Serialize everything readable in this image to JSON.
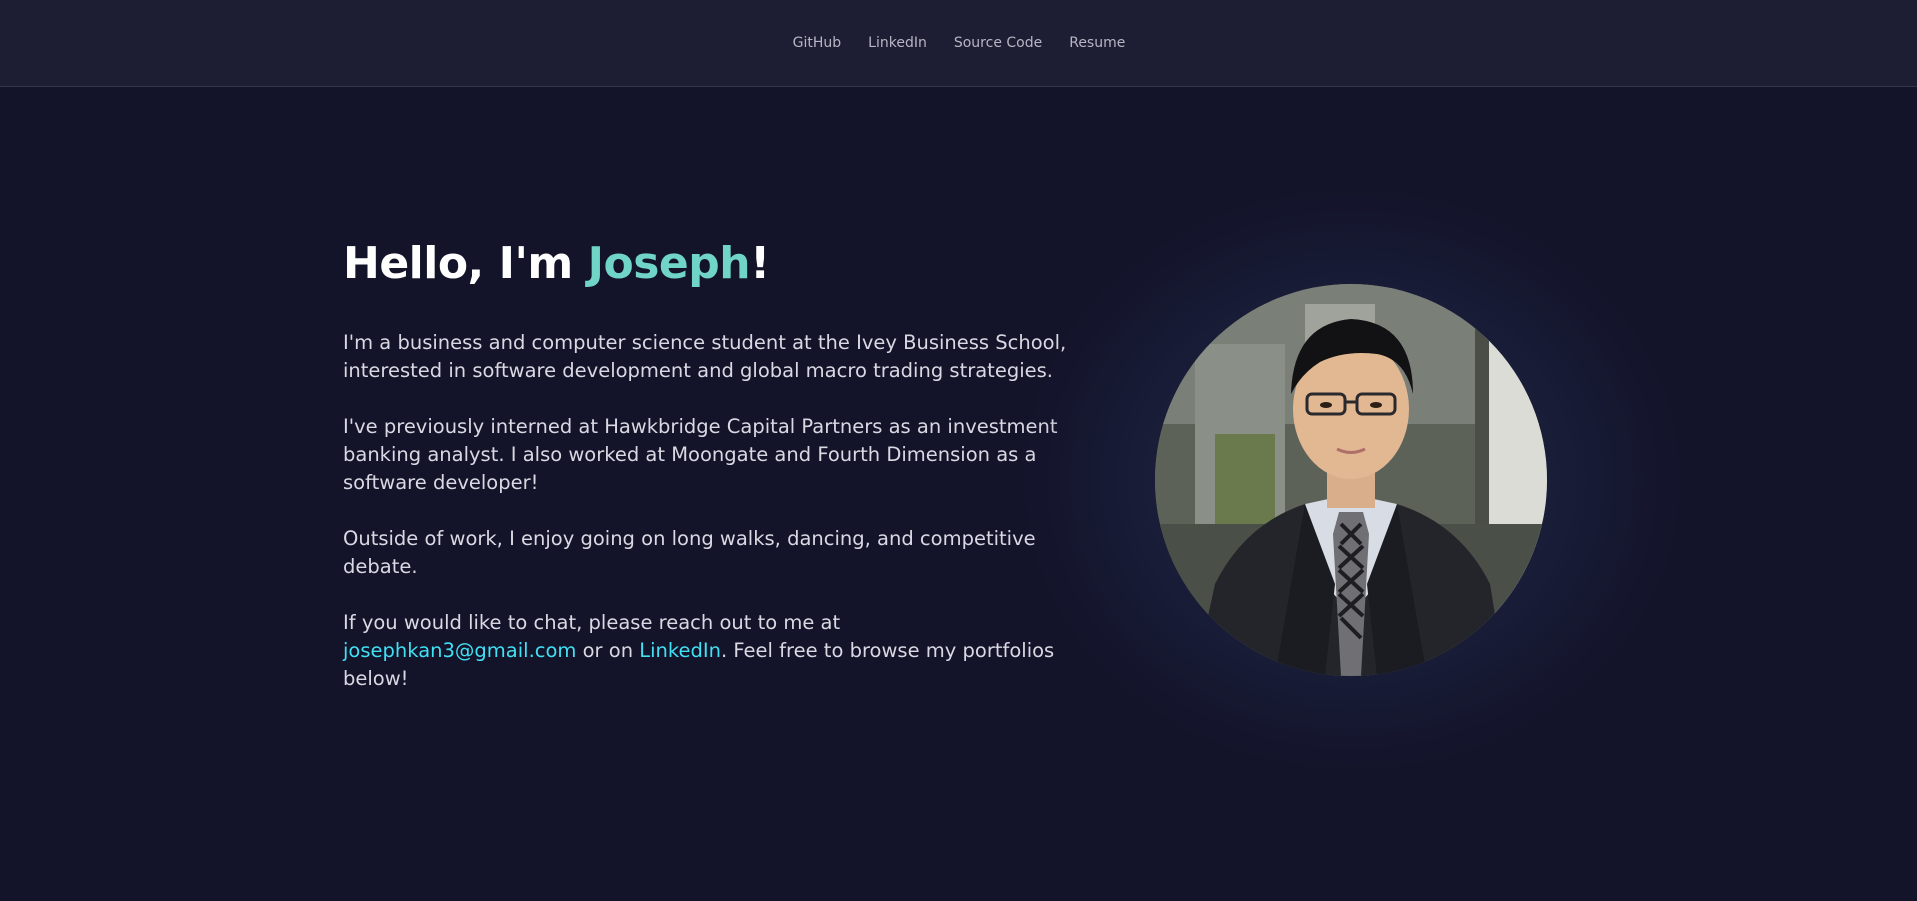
{
  "nav": {
    "items": [
      {
        "label": "GitHub"
      },
      {
        "label": "LinkedIn"
      },
      {
        "label": "Source Code"
      },
      {
        "label": "Resume"
      }
    ]
  },
  "hero": {
    "title_prefix": "Hello, I'm ",
    "title_name": "Joseph",
    "title_suffix": "!",
    "paragraph1": "I'm a business and computer science student at the Ivey Business School, interested in software development and global macro trading strategies.",
    "paragraph2": "I've previously interned at Hawkbridge Capital Partners as an investment banking analyst. I also worked at Moongate and Fourth Dimension as a software developer!",
    "paragraph3": "Outside of work, I enjoy going on long walks, dancing, and competitive debate.",
    "paragraph4_prefix": "If you would like to chat, please reach out to me at ",
    "email": "josephkan3@gmail.com",
    "paragraph4_middle": " or on ",
    "linkedin_link": "LinkedIn",
    "paragraph4_suffix": ". Feel free to browse my portfolios below!"
  },
  "colors": {
    "background": "#13132a",
    "navbar": "#1d1d33",
    "accent_name": "#70d4c6",
    "link": "#41e0f2"
  }
}
